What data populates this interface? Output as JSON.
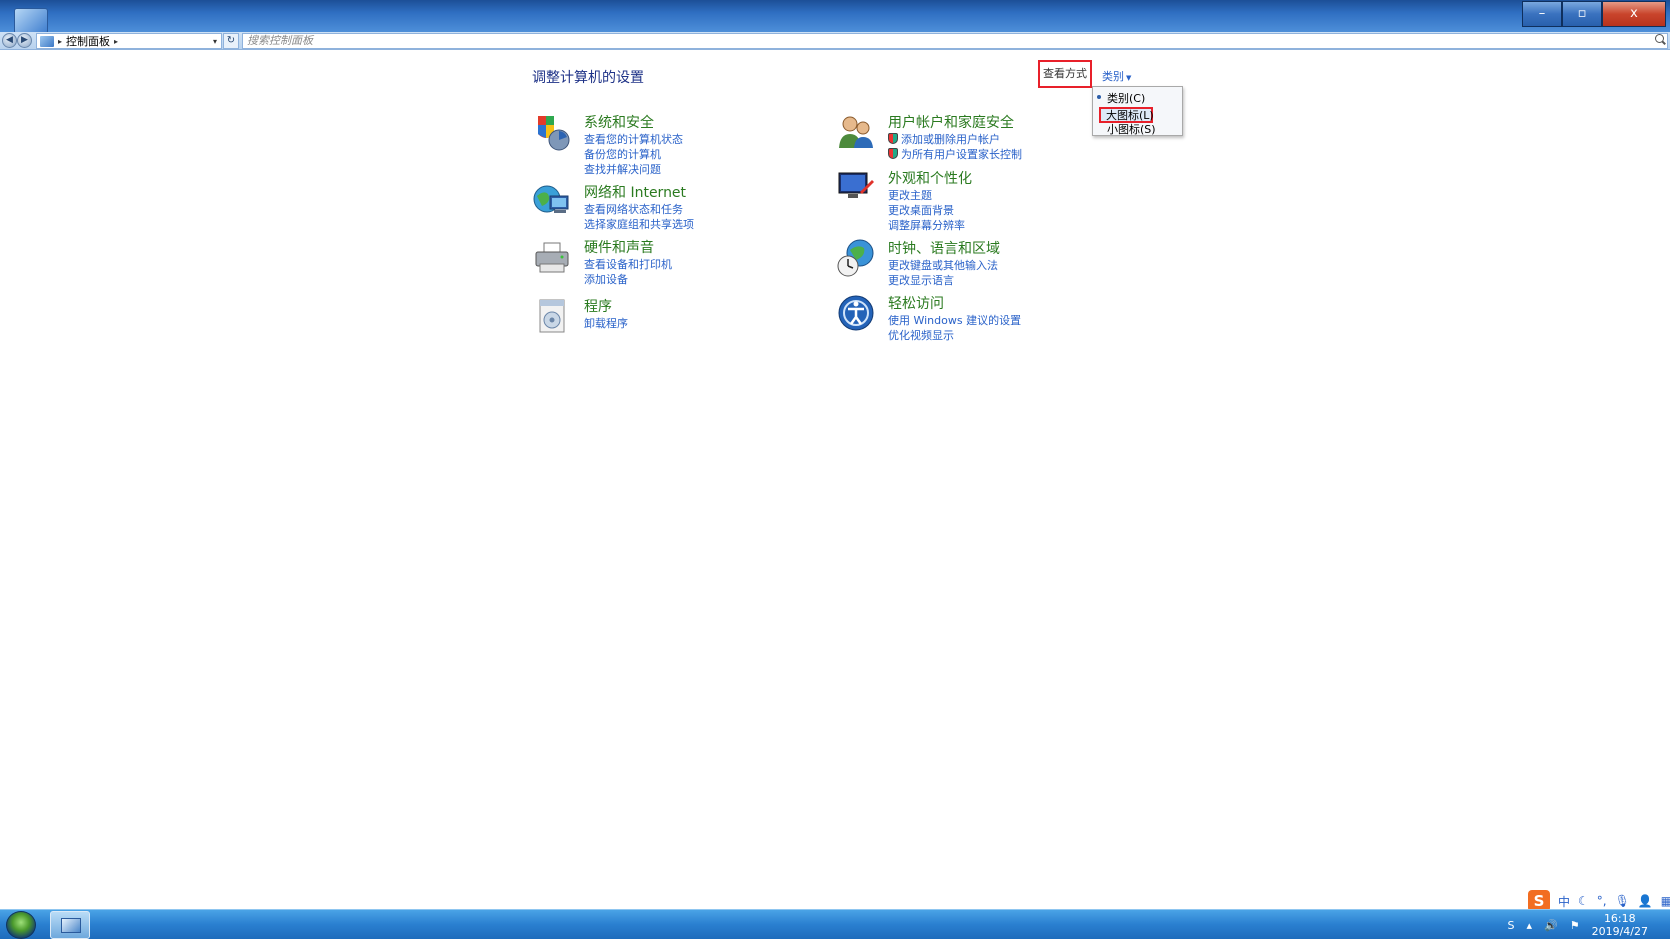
{
  "window": {
    "controls": {
      "minimize": "–",
      "restore": "▫",
      "close": "x"
    }
  },
  "address": {
    "back": "◀",
    "forward": "▶",
    "crumb": "控制面板",
    "refresh": "↻",
    "search_placeholder": "搜索控制面板"
  },
  "main": {
    "heading": "调整计算机的设置",
    "view_by_label": "查看方式",
    "view_by_value": "类别",
    "view_menu": [
      "类别(C)",
      "大图标(L)",
      "小图标(S)"
    ]
  },
  "categories": [
    {
      "title": "系统和安全",
      "icon": "shield-pc-icon",
      "links": [
        "查看您的计算机状态",
        "备份您的计算机",
        "查找并解决问题"
      ]
    },
    {
      "title": "网络和 Internet",
      "icon": "network-globe-icon",
      "links": [
        "查看网络状态和任务",
        "选择家庭组和共享选项"
      ]
    },
    {
      "title": "硬件和声音",
      "icon": "printer-icon",
      "links": [
        "查看设备和打印机",
        "添加设备"
      ]
    },
    {
      "title": "程序",
      "icon": "programs-icon",
      "links": [
        "卸载程序"
      ]
    },
    {
      "title": "用户帐户和家庭安全",
      "icon": "users-icon",
      "links": [
        "添加或删除用户帐户",
        "为所有用户设置家长控制"
      ]
    },
    {
      "title": "外观和个性化",
      "icon": "appearance-icon",
      "links": [
        "更改主题",
        "更改桌面背景",
        "调整屏幕分辨率"
      ]
    },
    {
      "title": "时钟、语言和区域",
      "icon": "clock-globe-icon",
      "links": [
        "更改键盘或其他输入法",
        "更改显示语言"
      ]
    },
    {
      "title": "轻松访问",
      "icon": "ease-of-access-icon",
      "links": [
        "使用 Windows 建议的设置",
        "优化视频显示"
      ]
    }
  ],
  "taskbar": {
    "ime": {
      "logo": "S",
      "mode": "中"
    },
    "clock": {
      "time": "16:18",
      "date": "2019/4/27"
    }
  },
  "colors": {
    "link": "#2a62c9",
    "category_title": "#2a7a1f",
    "heading": "#1e3287",
    "highlight": "#e8202a"
  }
}
